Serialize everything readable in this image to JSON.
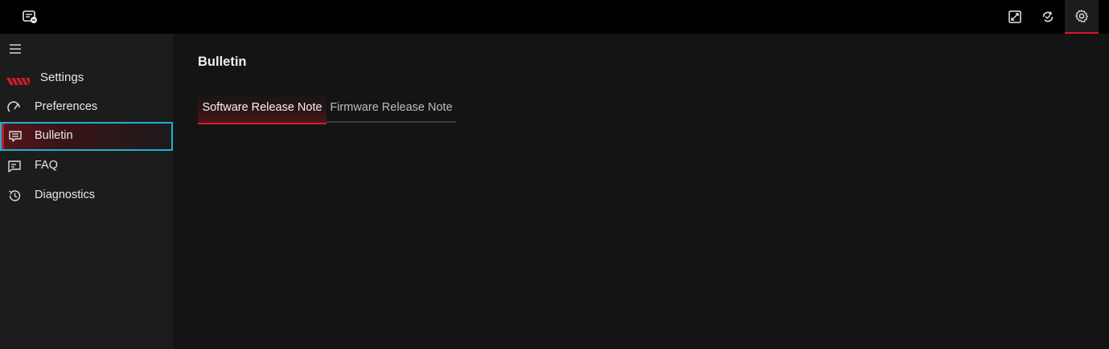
{
  "header": {
    "app_icon": "bulletin-app-icon",
    "buttons": [
      {
        "icon": "screen-capture-icon",
        "active": false
      },
      {
        "icon": "sync-check-icon",
        "active": false
      },
      {
        "icon": "gear-icon",
        "active": true
      }
    ]
  },
  "sidebar": {
    "brand_label": "Settings",
    "items": [
      {
        "label": "Preferences",
        "icon": "speed-gauge-icon"
      },
      {
        "label": "Bulletin",
        "icon": "message-icon",
        "selected": true
      },
      {
        "label": "FAQ",
        "icon": "chat-bubble-icon"
      },
      {
        "label": "Diagnostics",
        "icon": "history-icon"
      }
    ]
  },
  "main": {
    "title": "Bulletin",
    "tabs": [
      {
        "label": "Software Release Note",
        "active": true
      },
      {
        "label": "Firmware Release Note",
        "active": false
      }
    ]
  },
  "colors": {
    "accent_red": "#d61a2b",
    "focus_cyan": "#1ab3cf",
    "sidebar_bg": "#1c1c1c",
    "main_bg": "#141414",
    "topbar_bg": "#000000"
  }
}
